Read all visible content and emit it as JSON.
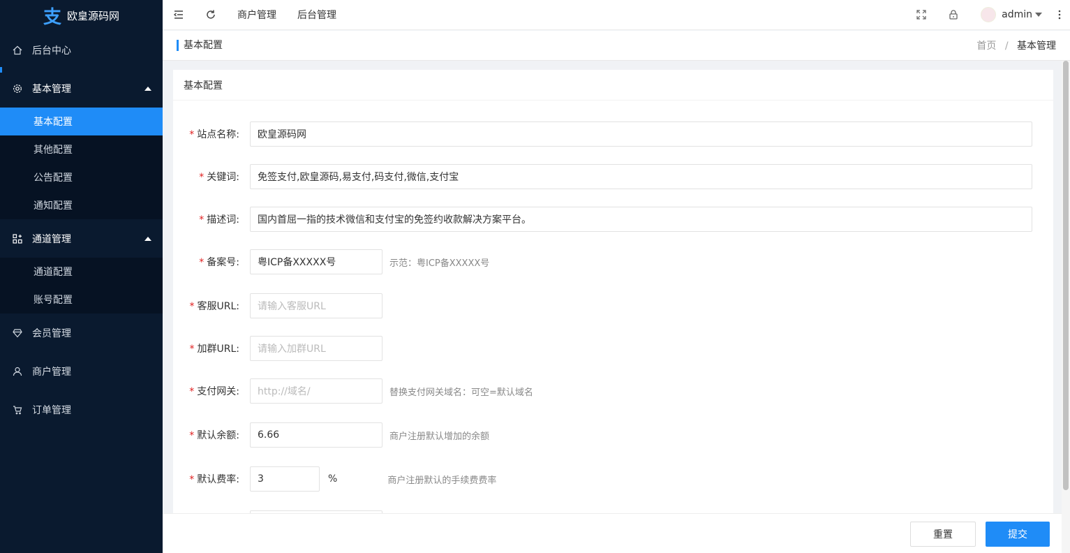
{
  "sidebar": {
    "logo_glyph": "支",
    "logo_text": "欧皇源码网",
    "items": [
      {
        "label": "后台中心",
        "icon": "home-icon"
      },
      {
        "label": "基本管理",
        "icon": "gear-icon",
        "open": true,
        "children": [
          {
            "label": "基本配置",
            "active": true
          },
          {
            "label": "其他配置"
          },
          {
            "label": "公告配置"
          },
          {
            "label": "通知配置"
          }
        ]
      },
      {
        "label": "通道管理",
        "icon": "apps-icon",
        "open": true,
        "children": [
          {
            "label": "通道配置"
          },
          {
            "label": "账号配置"
          }
        ]
      },
      {
        "label": "会员管理",
        "icon": "diamond-icon"
      },
      {
        "label": "商户管理",
        "icon": "user-icon"
      },
      {
        "label": "订单管理",
        "icon": "cart-icon"
      }
    ]
  },
  "topbar": {
    "links": [
      "商户管理",
      "后台管理"
    ],
    "username": "admin"
  },
  "pagebar": {
    "title": "基本配置",
    "breadcrumb_home": "首页",
    "breadcrumb_sep": "/",
    "breadcrumb_current": "基本管理"
  },
  "card": {
    "title": "基本配置",
    "fields": [
      {
        "label": "站点名称:",
        "value": "欧皇源码网"
      },
      {
        "label": "关键词:",
        "value": "免签支付,欧皇源码,易支付,码支付,微信,支付宝"
      },
      {
        "label": "描述词:",
        "value": "国内首屈一指的技术微信和支付宝的免签约收款解决方案平台。"
      },
      {
        "label": "备案号:",
        "value": "粤ICP备XXXXX号",
        "hint": "示范：粤ICP备XXXXX号"
      },
      {
        "label": "客服URL:",
        "placeholder": "请输入客服URL"
      },
      {
        "label": "加群URL:",
        "placeholder": "请输入加群URL"
      },
      {
        "label": "支付网关:",
        "placeholder": "http://域名/",
        "hint": "替换支付网关域名：可空=默认域名"
      },
      {
        "label": "默认余额:",
        "value": "6.66",
        "hint": "商户注册默认增加的余额"
      },
      {
        "label": "默认费率:",
        "value": "3",
        "unit": "%",
        "hint": "商户注册默认的手续费费率"
      }
    ]
  },
  "footer": {
    "reset": "重置",
    "submit": "提交"
  },
  "colors": {
    "sidebar_bg": "#0a1a2f",
    "accent": "#1f8cf7",
    "required": "#e02020"
  }
}
